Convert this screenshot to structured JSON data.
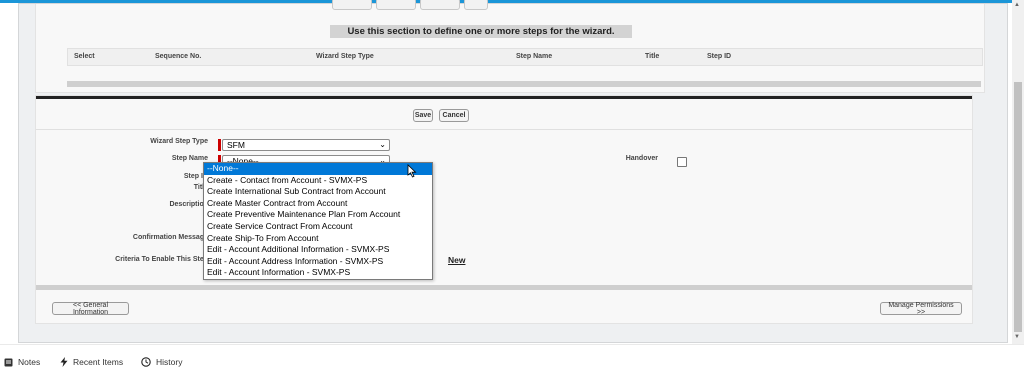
{
  "wizard_steps": {
    "banner": "Use this section to define one or more steps for the wizard.",
    "columns": [
      "Select",
      "Sequence No.",
      "Wizard Step Type",
      "Step Name",
      "Title",
      "Step ID"
    ]
  },
  "actions": {
    "save_label": "Save",
    "cancel_label": "Cancel"
  },
  "form": {
    "wizard_step_type_label": "Wizard Step Type",
    "wizard_step_type_value": "SFM",
    "step_name_label": "Step Name",
    "step_name_value": "--None--",
    "step_id_label": "Step ID",
    "title_label": "Title",
    "description_label": "Description",
    "confirmation_message_label": "Confirmation Message",
    "criteria_label": "Criteria To Enable This Step",
    "handover_label": "Handover",
    "new_link": "New"
  },
  "dropdown": {
    "options": [
      "--None--",
      "Create - Contact from Account - SVMX-PS",
      "Create International Sub Contract from Account",
      "Create Master Contract from Account",
      "Create Preventive Maintenance Plan From Account",
      "Create Service Contract From Account",
      "Create Ship-To From Account",
      "Edit - Account Additional Information - SVMX-PS",
      "Edit - Account Address Information - SVMX-PS",
      "Edit - Account Information - SVMX-PS"
    ],
    "selected_index": 0
  },
  "nav": {
    "back_label": "<< General Information",
    "manage_permissions_label": "Manage Permissions >>"
  },
  "footer": {
    "notes": "Notes",
    "recent_items": "Recent Items",
    "history": "History"
  },
  "colors": {
    "highlight": "#0078d7",
    "required": "#cc0000",
    "accent": "#1b96d8"
  }
}
